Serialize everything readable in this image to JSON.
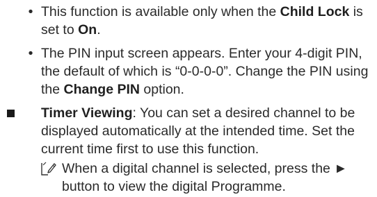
{
  "bullet1": {
    "marker": "•",
    "pre": "This function is available only when the ",
    "b1": "Child Lock",
    "mid": " is set to ",
    "b2": "On",
    "post": "."
  },
  "bullet2": {
    "marker": "•",
    "pre": "The PIN input screen appears. Enter your 4-digit PIN, the default of which is “0-0-0-0”. Change the PIN using the ",
    "b1": "Change PIN",
    "post": " option."
  },
  "timer": {
    "title": "Timer Viewing",
    "text": ": You can set a desired channel to be displayed automatically at the intended time. Set the current time first to use this function."
  },
  "note": {
    "icon": "note-pencil-icon",
    "text": "When a digital channel is selected, press the ► button to view the digital Programme."
  }
}
